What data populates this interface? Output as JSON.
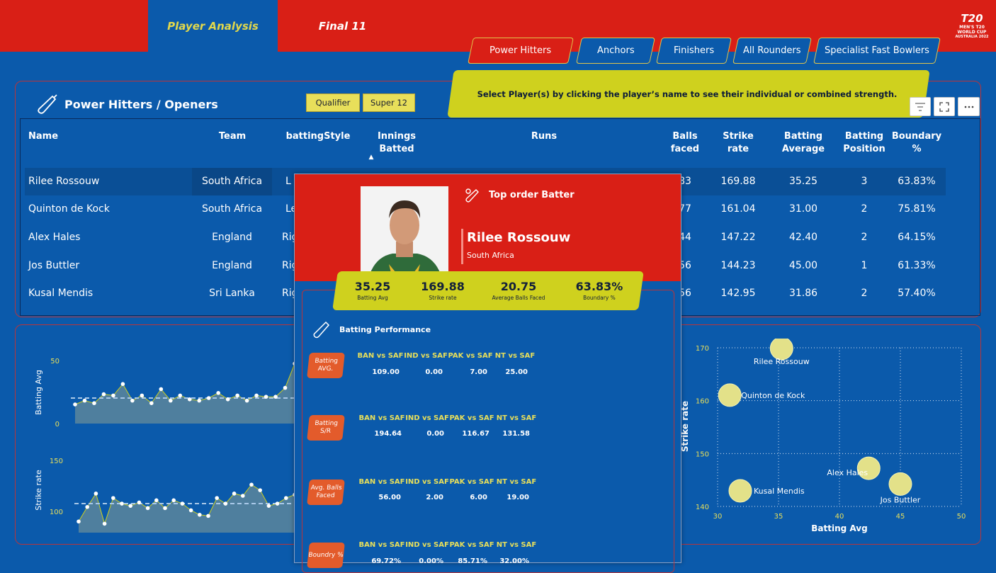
{
  "nav": {
    "tabs": [
      {
        "label": "Player Analysis"
      },
      {
        "label": "Final 11"
      }
    ]
  },
  "logo": {
    "mark": "T20",
    "line1": "MEN'S T20",
    "line2": "WORLD CUP",
    "line3": "AUSTRALIA 2022"
  },
  "categories": [
    "Power Hitters",
    "Anchors",
    "Finishers",
    "All Rounders",
    "Specialist Fast Bowlers"
  ],
  "banner": "Select Player(s) by clicking the player’s name to see their individual or combined strength.",
  "panel": {
    "title": "Power Hitters / Openers",
    "filters": [
      "Qualifier",
      "Super 12"
    ],
    "tools": [
      "filter-icon",
      "focus-mode-icon",
      "more-options-icon"
    ]
  },
  "table": {
    "columns": [
      "Name",
      "Team",
      "battingStyle",
      "Innings Batted",
      "Runs",
      "Balls faced",
      "Strike rate",
      "Batting Average",
      "Batting Position",
      "Boundary %"
    ],
    "sort_indicator": "▲",
    "rows": [
      {
        "name": "Rilee Rossouw",
        "team": "South Africa",
        "style": "L",
        "balls": "83",
        "sr": "169.88",
        "avg": "35.25",
        "pos": "3",
        "boundary": "63.83%"
      },
      {
        "name": "Quinton de Kock",
        "team": "South Africa",
        "style": "Le",
        "balls": "77",
        "sr": "161.04",
        "avg": "31.00",
        "pos": "2",
        "boundary": "75.81%"
      },
      {
        "name": "Alex Hales",
        "team": "England",
        "style": "Rig",
        "balls": "44",
        "sr": "147.22",
        "avg": "42.40",
        "pos": "2",
        "boundary": "64.15%"
      },
      {
        "name": "Jos Buttler",
        "team": "England",
        "style": "Rig",
        "balls": "56",
        "sr": "144.23",
        "avg": "45.00",
        "pos": "1",
        "boundary": "61.33%"
      },
      {
        "name": "Kusal Mendis",
        "team": "Sri Lanka",
        "style": "Rig",
        "balls": "56",
        "sr": "142.95",
        "avg": "31.86",
        "pos": "2",
        "boundary": "57.40%"
      }
    ]
  },
  "popup": {
    "role": "Top order Batter",
    "name": "Rilee Rossouw",
    "team": "South Africa",
    "stats": [
      {
        "value": "35.25",
        "label": "Batting Avg"
      },
      {
        "value": "169.88",
        "label": "Strike rate"
      },
      {
        "value": "20.75",
        "label": "Average Balls Faced"
      },
      {
        "value": "63.83%",
        "label": "Boundary %"
      }
    ],
    "section_title": "Batting Performance",
    "metrics": [
      {
        "label": "Batting AVG.",
        "headers": [
          "BAN vs SAF",
          "IND vs SAF",
          "PAK vs SAF",
          "NT vs SAF"
        ],
        "values": [
          "109.00",
          "0.00",
          "7.00",
          "25.00"
        ]
      },
      {
        "label": "Batting S/R",
        "headers": [
          "BAN vs SAF",
          "IND vs SAF",
          "PAK vs SAF",
          "NT vs SAF"
        ],
        "values": [
          "194.64",
          "0.00",
          "116.67",
          "131.58"
        ]
      },
      {
        "label": "Avg. Balls Faced",
        "headers": [
          "BAN vs SAF",
          "IND vs SAF",
          "PAK vs SAF",
          "NT vs SAF"
        ],
        "values": [
          "56.00",
          "2.00",
          "6.00",
          "19.00"
        ]
      },
      {
        "label": "Boundry %",
        "headers": [
          "BAN vs SAF",
          "IND vs SAF",
          "PAK vs SAF",
          "NT vs SAF"
        ],
        "values": [
          "69.72%",
          "0.00%",
          "85.71%",
          "32.00%"
        ]
      }
    ]
  },
  "chart_data": [
    {
      "type": "area",
      "ylabel": "Batting Avg",
      "ylim": [
        0,
        50
      ],
      "yticks": [
        "50",
        "0"
      ],
      "reference_line": 20,
      "values": [
        15,
        18,
        16,
        23,
        22,
        31,
        18,
        22,
        16,
        27,
        18,
        22,
        19,
        18,
        20,
        24,
        19,
        22,
        18,
        22,
        21,
        21,
        28,
        47
      ]
    },
    {
      "type": "area",
      "ylabel": "Strike rate",
      "ylim": [
        92,
        158
      ],
      "yticks": [
        "150",
        "100"
      ],
      "reference_line": 118,
      "values": [
        102,
        115,
        127,
        100,
        123,
        118,
        116,
        119,
        114,
        121,
        114,
        121,
        118,
        112,
        108,
        107,
        123,
        118,
        127,
        125,
        135,
        130,
        116,
        118,
        123,
        126
      ]
    },
    {
      "type": "scatter",
      "xlabel": "Batting Avg",
      "ylabel": "Strike rate",
      "xlim": [
        30,
        50
      ],
      "ylim": [
        140,
        170
      ],
      "xticks": [
        30,
        35,
        40,
        45,
        50
      ],
      "yticks": [
        140,
        150,
        160,
        170
      ],
      "points": [
        {
          "name": "Rilee Rossouw",
          "x": 35.25,
          "y": 169.88
        },
        {
          "name": "Quinton de Kock",
          "x": 31.0,
          "y": 161.04
        },
        {
          "name": "Alex Hales",
          "x": 42.4,
          "y": 147.22
        },
        {
          "name": "Jos Buttler",
          "x": 45.0,
          "y": 144.23
        },
        {
          "name": "Kusal Mendis",
          "x": 31.86,
          "y": 142.95
        }
      ]
    }
  ]
}
